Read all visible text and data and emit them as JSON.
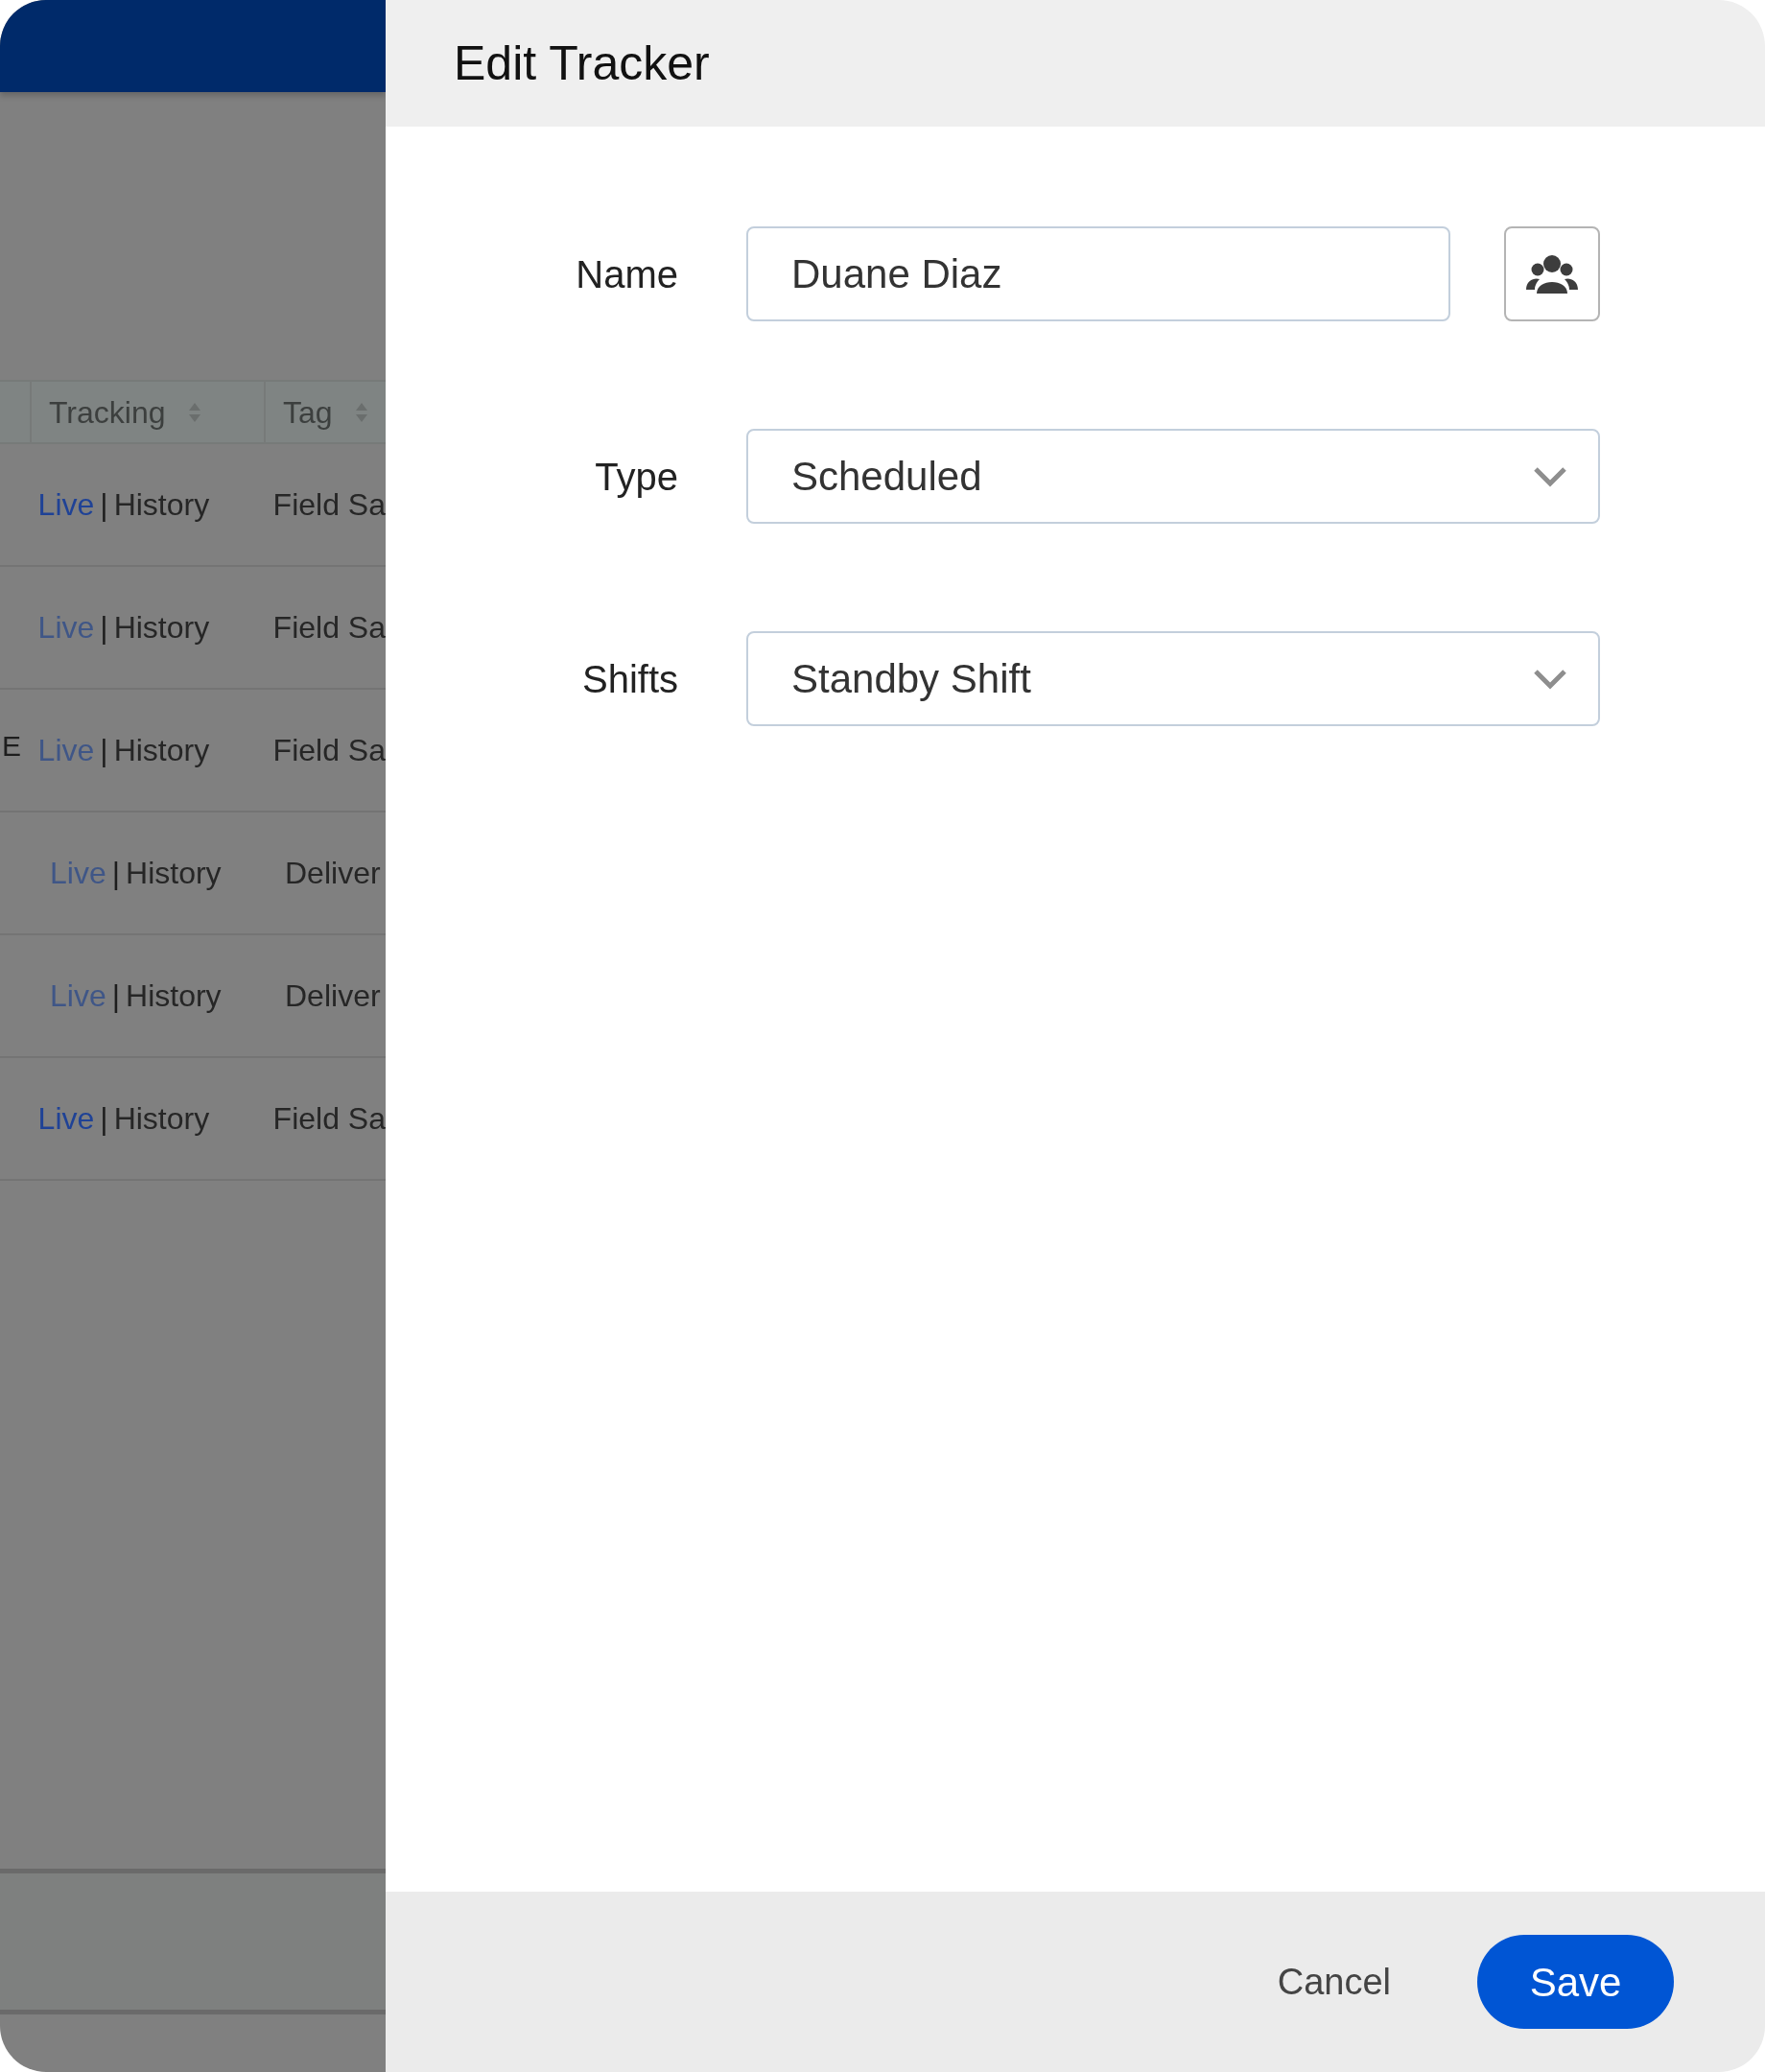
{
  "background_table": {
    "columns": [
      {
        "label": "Tracking"
      },
      {
        "label": "Tag"
      }
    ],
    "rows": [
      {
        "live": "Live",
        "separator": "|",
        "history": "History",
        "tag": "Field Sa",
        "live_active": true
      },
      {
        "live": "Live",
        "separator": "|",
        "history": "History",
        "tag": "Field Sa",
        "live_active": false
      },
      {
        "column_1": "E",
        "live": "Live",
        "separator": "|",
        "history": "History",
        "tag": "Field Sa",
        "live_active": false
      },
      {
        "live": "Live",
        "separator": "|",
        "history": "History",
        "tag": "Deliver",
        "live_active": false
      },
      {
        "live": "Live",
        "separator": "|",
        "history": "History",
        "tag": "Deliver",
        "live_active": false
      },
      {
        "live": "Live",
        "separator": "|",
        "history": "History",
        "tag": "Field Sa",
        "live_active": true
      }
    ]
  },
  "dialog": {
    "title": "Edit Tracker",
    "fields": [
      {
        "kind": "text",
        "label": "Name",
        "value": "Duane Diaz"
      },
      {
        "kind": "select",
        "label": "Type",
        "value": "Scheduled"
      },
      {
        "kind": "select",
        "label": "Shifts",
        "value": "Standby Shift"
      }
    ],
    "buttons": {
      "cancel": "Cancel",
      "save": "Save"
    }
  }
}
